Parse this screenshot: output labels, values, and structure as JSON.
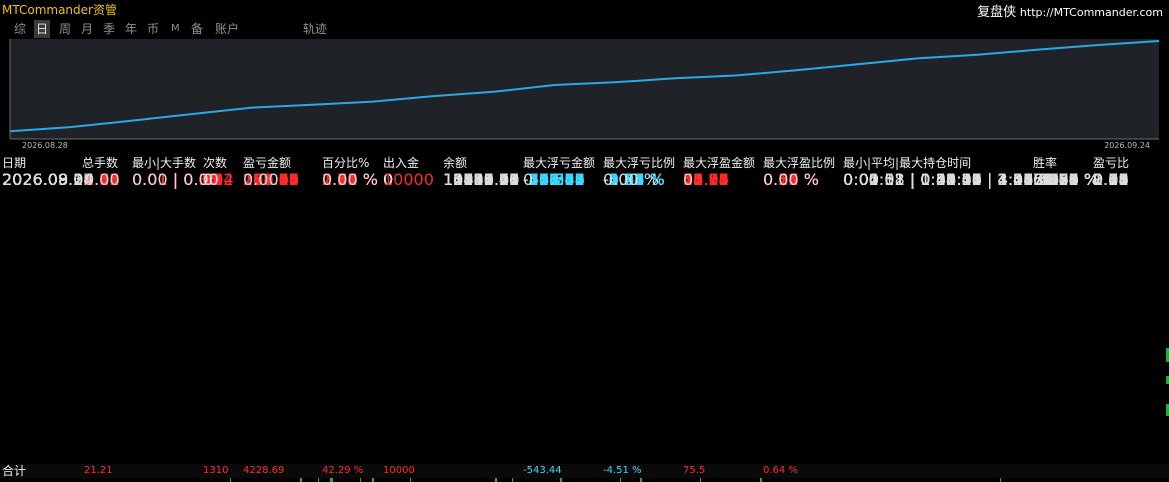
{
  "app": {
    "title": "MTCommander资管",
    "brand_cn": "复盘侠",
    "brand_url": "http://MTCommander.com"
  },
  "tabs": [
    {
      "label": "综",
      "active": false
    },
    {
      "label": "日",
      "active": true
    },
    {
      "label": "周",
      "active": false
    },
    {
      "label": "月",
      "active": false
    },
    {
      "label": "季",
      "active": false
    },
    {
      "label": "年",
      "active": false
    },
    {
      "label": "币",
      "active": false
    },
    {
      "label": "M",
      "active": false
    },
    {
      "label": "备",
      "active": false
    },
    {
      "label": "账户",
      "active": false
    },
    {
      "label": "轨迹",
      "active": false
    }
  ],
  "chart_data": {
    "type": "line",
    "x_start_label": "2026.08.28",
    "x_end_label": "2026.09.24",
    "x": [
      "2026.08.28",
      "2026.08.31",
      "2026.09.01",
      "2026.09.02",
      "2026.09.03",
      "2026.09.04",
      "2026.09.07",
      "2026.09.08",
      "2026.09.09",
      "2026.09.10",
      "2026.09.11",
      "2026.09.14",
      "2026.09.15",
      "2026.09.16",
      "2026.09.17",
      "2026.09.18",
      "2026.09.21",
      "2026.09.22",
      "2026.09.23",
      "2026.09.24"
    ],
    "values": [
      10254.91,
      10436.21,
      10712.6,
      11010.0,
      11293.07,
      11422.11,
      11557.93,
      11800.55,
      11990.9,
      12290.04,
      12410.76,
      12585.9,
      12709.47,
      12938.4,
      13196.16,
      13461.28,
      13623.62,
      13849.79,
      14052.01,
      14228.69
    ],
    "grid": false,
    "line_color": "#2aa8e8"
  },
  "table": {
    "headers": [
      "日期",
      "总手数",
      "最小|大手数",
      "次数",
      "盈亏金额",
      "百分比%",
      "出入金",
      "余额",
      "最大浮亏金额",
      "最大浮亏比例",
      "最大浮盈金额",
      "最大浮盈比例",
      "最小|平均|最大持仓时间",
      "胜率",
      "盈亏比"
    ],
    "rows": [
      [
        "2026.09.24",
        "0.71",
        "0.01 | 0.03",
        "54",
        "176.68",
        "1.26 %",
        "0",
        "14228.69",
        "-79.35",
        "-0.56 %",
        "12.9",
        "0.09 %",
        "0:00:01 | 0:34:32 | 2:44:25",
        "64.81 %",
        "1.31"
      ],
      [
        "2026.09.23",
        "0.84",
        "0.01 | 0.04",
        "62",
        "202.22",
        "1.46 %",
        "0",
        "14052.01",
        "-209.34",
        "-1.51 %",
        "15.13",
        "0.11 %",
        "0:00:01 | 0:55:46 | 3:41:40",
        "67.74 %",
        "1.10"
      ],
      [
        "2026.09.22",
        "0.94",
        "0.01 | 0.03",
        "69",
        "226.17",
        "1.66 %",
        "0",
        "13849.79",
        "-111.19",
        "-0.81 %",
        "22.53",
        "0.16 %",
        "0:01:51 | 0:22:04 | 2:08:01",
        "65.22 %",
        "1.10"
      ],
      [
        "2026.09.21",
        "0.38",
        "0.01 | 0.03",
        "33",
        "162.34",
        "1.21 %",
        "0",
        "13623.62",
        "-64.76",
        "-0.48 %",
        "16.04",
        "0.12 %",
        "0:04:38 | 0:28:56 | 1:52:58",
        "78.79 %",
        "2.09"
      ],
      [
        "2026.09.18",
        "1.04",
        "0.01 | 0.07",
        "68",
        "265.12",
        "2.01 %",
        "0",
        "13461.28",
        "-543.44",
        "-4.06 %",
        "75.5",
        "0.56 %",
        "0:00:01 | 0:50:09 | 4:34:20",
        "63.24 %",
        "1.05"
      ],
      [
        "2026.09.17",
        "1.39",
        "0.01 | 0.05",
        "87",
        "257.76",
        "1.99 %",
        "0",
        "13196.16",
        "-256.65",
        "-1.96 %",
        "41.28",
        "0.32 %",
        "0:00:01 | 0:25:14 | 2:01:01",
        "57.47 %",
        "0.88"
      ],
      [
        "2026.09.16",
        "1.31",
        "0.01 | 0.10",
        "73",
        "228.93",
        "1.80 %",
        "0",
        "12938.40",
        "-325.69",
        "-2.56 %",
        "34.96",
        "0.28 %",
        "0:00:01 | 0:34:21 | 2:24:29",
        "61.64 %",
        "0.66"
      ],
      [
        "2026.09.15",
        "0.49",
        "0.01 | 0.03",
        "41",
        "123.57",
        "0.98 %",
        "0",
        "12709.47",
        "-68.66",
        "-0.54 %",
        "15.04",
        "0.12 %",
        "0:00:01 | 0:36:59 | 2:05:33",
        "70.73 %",
        "1.38"
      ],
      [
        "2026.09.14",
        "0.79",
        "0.01 | 0.04",
        "54",
        "175.14",
        "1.41 %",
        "0",
        "12585.90",
        "-212.48",
        "-1.69 %",
        "17.26",
        "0.14 %",
        "0:00:01 | 0:31:16 | 3:01:24",
        "59.26 %",
        "1.14"
      ],
      [
        "2026.09.11",
        "0.31",
        "0.01 | 0.03",
        "25",
        "120.72",
        "0.98 %",
        "0",
        "12410.76",
        "-76.06",
        "-0.61 %",
        "35.51",
        "0.29 %",
        "0:02:12 | 1:00:12 | 4:18:26",
        "72.00 %",
        "1.75"
      ],
      [
        "2026.09.10",
        "1.19",
        "0.01 | 0.05",
        "81",
        "299.14",
        "2.49 %",
        "0",
        "12290.04",
        "-346.58",
        "-2.85 %",
        "35.19",
        "0.29 %",
        "0:00:01 | 0:21:25 | 1:55:05",
        "61.73 %",
        "1.01"
      ],
      [
        "2026.09.09",
        "1.33",
        "0.01 | 0.07",
        "79",
        "190.35",
        "1.61 %",
        "0",
        "11990.90",
        "-470.07",
        "-3.95 %",
        "29.92",
        "0.25 %",
        "0:00:01 | 0:42:47 | 4:17:02",
        "56.96 %",
        "0.70"
      ],
      [
        "2026.09.08",
        "1.12",
        "0.01 | 0.08",
        "54",
        "242.62",
        "2.10 %",
        "0",
        "11800.55",
        "-328.06",
        "-2.81 %",
        "30.07",
        "0.26 %",
        "0:00:01 | 1:16:41 | 4:05:05",
        "59.26 %",
        "0.73"
      ],
      [
        "2026.09.07",
        "1.03",
        "0.01 | 0.04",
        "62",
        "135.82",
        "1.19 %",
        "0",
        "11557.93",
        "-254.58",
        "-2.21 %",
        "14.24",
        "0.12 %",
        "0:00:01 | 0:58:27 | 3:17:59",
        "51.61 %",
        "0.84"
      ],
      [
        "2026.09.04",
        "0.88",
        "0.01 | 0.04",
        "61",
        "129.04",
        "1.14 %",
        "0",
        "11422.11",
        "-70.76",
        "-0.62 %",
        "13.33",
        "0.12 %",
        "0:00:01 | 0:49:55 | 4:09:39",
        "60.66 %",
        "0.90"
      ],
      [
        "2026.09.03",
        "1.78",
        "0.01 | 0.06",
        "102",
        "283.07",
        "2.57 %",
        "0",
        "11293.07",
        "-367.31",
        "-3.27 %",
        "71.95",
        "0.64 %",
        "0:00:01 | 0:31:21 | 3:26:20",
        "55.88 %",
        "0.69"
      ],
      [
        "2026.09.02",
        "2.70",
        "0.01 | 0.30",
        "104",
        "297.40",
        "2.78 %",
        "0",
        "11010.00",
        "-492.92",
        "-4.51 %",
        "38.12",
        "0.35 %",
        "0:00:01 | 0:33:51 | 3:46:27",
        "57.69 %",
        "0.49"
      ],
      [
        "2026.09.01",
        "1.35",
        "0.01 | 0.05",
        "95",
        "276.39",
        "2.65 %",
        "0",
        "10712.60",
        "-272.73",
        "-2.58 %",
        "35.63",
        "0.34 %",
        "0:00:01 | 0:22:26 | 1:45:00",
        "57.89 %",
        "1.11"
      ],
      [
        "2026.08.31",
        "0.59",
        "0.01 | 0.04",
        "46",
        "181.30",
        "1.77 %",
        "0",
        "10436.21",
        "-147.78",
        "-1.42 %",
        "17.77",
        "0.17 %",
        "0:01:11 | 0:25:56 | 1:31:06",
        "73.91 %",
        "1.27"
      ],
      [
        "2026.08.28",
        "1.04",
        "0.01 | 0.06",
        "60",
        "254.91",
        "2.55 %",
        "0",
        "10254.91",
        "-205.77",
        "-2.05 %",
        "53.11",
        "0.53 %",
        "0:00:01 | 0:26:18 | 2:28:16",
        "60.00 %",
        "0.86"
      ],
      [
        "2026.08.14",
        "0.00",
        "0.00 | 0.00",
        "0",
        "0.00",
        "0.00 %",
        "10000",
        "10000.00",
        "0",
        "0.00 %",
        "0",
        "0.00 %",
        "",
        "",
        ""
      ]
    ],
    "total": {
      "label": "合计",
      "lots": "21.21",
      "count": "1310",
      "pnl": "4228.69",
      "percent": "42.29 %",
      "deposit": "10000",
      "max_float_loss": "-543.44",
      "max_float_loss_pct": "-4.51 %",
      "max_float_profit": "75.5",
      "max_float_profit_pct": "0.64 %"
    }
  },
  "colors": {
    "accent_title": "#f2c200",
    "negative": "#ff2a2a",
    "positive_line": "#2aa8e8",
    "plot_bg": "#1f2226"
  }
}
